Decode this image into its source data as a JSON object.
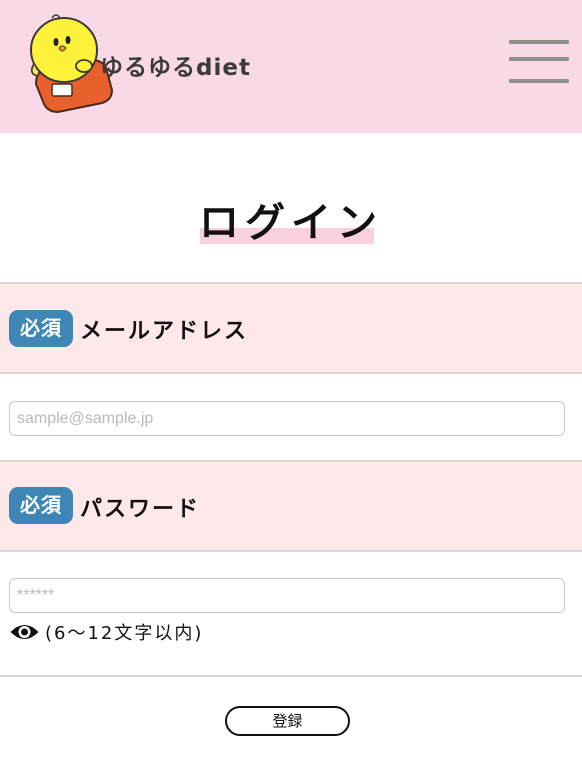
{
  "header": {
    "logo_text": "ゆるゆるdiet"
  },
  "page": {
    "title": "ログイン"
  },
  "form": {
    "required_badge": "必須",
    "email": {
      "label": "メールアドレス",
      "placeholder": "sample@sample.jp",
      "value": ""
    },
    "password": {
      "label": "パスワード",
      "placeholder": "******",
      "value": "",
      "hint": "(6〜12文字以内)"
    },
    "submit_label": "登録"
  },
  "colors": {
    "header_bg": "#f9d9e8",
    "label_section_bg": "#ffe8e9",
    "required_badge_bg": "#3d86b5",
    "title_underline": "#f9d0dd"
  },
  "icons": [
    "chick-mascot-logo",
    "hamburger-menu-icon",
    "eye-icon"
  ]
}
